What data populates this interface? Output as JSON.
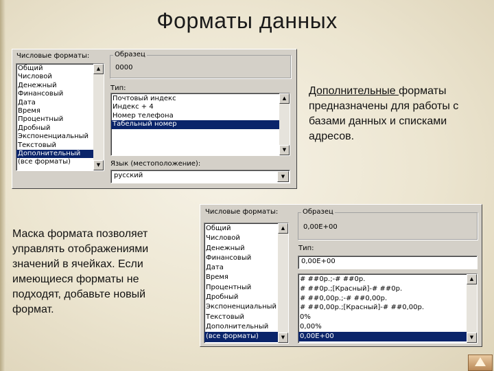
{
  "slide": {
    "title": "Форматы данных",
    "right_text_underlined": "Дополнительные ",
    "right_text_rest": "форматы предназначены для работы с базами данных и списками адресов.",
    "left_text": "Маска формата позволяет управлять отображениями значений в ячейках. Если имеющиеся форматы не подходят, добавьте новый формат."
  },
  "dialog1": {
    "categories_label": "Числовые форматы:",
    "categories": [
      "Общий",
      "Числовой",
      "Денежный",
      "Финансовый",
      "Дата",
      "Время",
      "Процентный",
      "Дробный",
      "Экспоненциальный",
      "Текстовый",
      "Дополнительный",
      "(все форматы)"
    ],
    "selected_category": "Дополнительный",
    "sample_label": "Образец",
    "sample_value": "0000",
    "type_label": "Тип:",
    "types": [
      "Почтовый индекс",
      "Индекс + 4",
      "Номер телефона",
      "Табельный номер"
    ],
    "selected_type": "Табельный номер",
    "locale_label": "Язык (местоположение):",
    "locale_value": "русский"
  },
  "dialog2": {
    "categories_label": "Числовые форматы:",
    "categories": [
      "Общий",
      "Числовой",
      "Денежный",
      "Финансовый",
      "Дата",
      "Время",
      "Процентный",
      "Дробный",
      "Экспоненциальный",
      "Текстовый",
      "Дополнительный",
      "(все форматы)"
    ],
    "selected_category": "(все форматы)",
    "sample_label": "Образец",
    "sample_value": "0,00E+00",
    "type_label": "Тип:",
    "type_input_value": "0,00E+00",
    "types": [
      "# ##0р.;-# ##0р.",
      "# ##0р.;[Красный]-# ##0р.",
      "# ##0,00р.;-# ##0,00р.",
      "# ##0,00р.;[Красный]-# ##0,00р.",
      "0%",
      "0,00%",
      "0,00E+00"
    ],
    "selected_type": "0,00E+00"
  },
  "icons": {
    "scroll_up": "▲",
    "scroll_down": "▼",
    "dropdown": "▼"
  },
  "colors": {
    "selection": "#0a246a",
    "dialog_face": "#d4d0c8"
  }
}
